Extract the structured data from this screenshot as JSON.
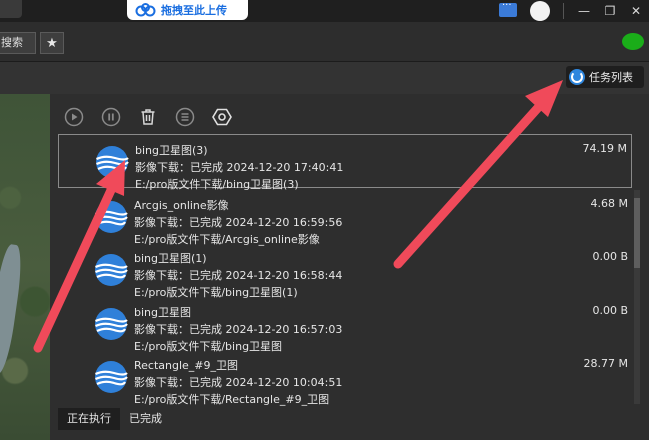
{
  "titlebar": {
    "upload_label": "拖拽至此上传",
    "icons": [
      "cloud-upload-icon",
      "message-icon",
      "avatar",
      "minimize-icon",
      "maximize-icon",
      "close-icon"
    ],
    "minimize": "—",
    "maximize": "❐",
    "close": "✕"
  },
  "toolbar": {
    "search_label": "搜索",
    "star_glyph": "★"
  },
  "task_list_button": "任务列表",
  "tasks": [
    {
      "name": "bing卫星图(3)",
      "status": "影像下载：已完成 2024-12-20 17:40:41",
      "path": "E:/pro版文件下载/bing卫星图(3)",
      "size": "74.19 M"
    },
    {
      "name": "Arcgis_online影像",
      "status": "影像下载：已完成 2024-12-20 16:59:56",
      "path": "E:/pro版文件下载/Arcgis_online影像",
      "size": "4.68 M"
    },
    {
      "name": "bing卫星图(1)",
      "status": "影像下载：已完成 2024-12-20 16:58:44",
      "path": "E:/pro版文件下载/bing卫星图(1)",
      "size": "0.00 B"
    },
    {
      "name": "bing卫星图",
      "status": "影像下载：已完成 2024-12-20 16:57:03",
      "path": "E:/pro版文件下载/bing卫星图",
      "size": "0.00 B"
    },
    {
      "name": "Rectangle_#9_卫图",
      "status": "影像下载：已完成 2024-12-20 10:04:51",
      "path": "E:/pro版文件下载/Rectangle_#9_卫图",
      "size": "28.77 M"
    }
  ],
  "tabs": [
    {
      "label": "正在执行"
    },
    {
      "label": "已完成"
    }
  ],
  "colors": {
    "accent": "#2e86de",
    "logo_blue": "#2f80d9",
    "arrow_red": "#f04a5a",
    "panel_bg": "#2e2e2e"
  }
}
